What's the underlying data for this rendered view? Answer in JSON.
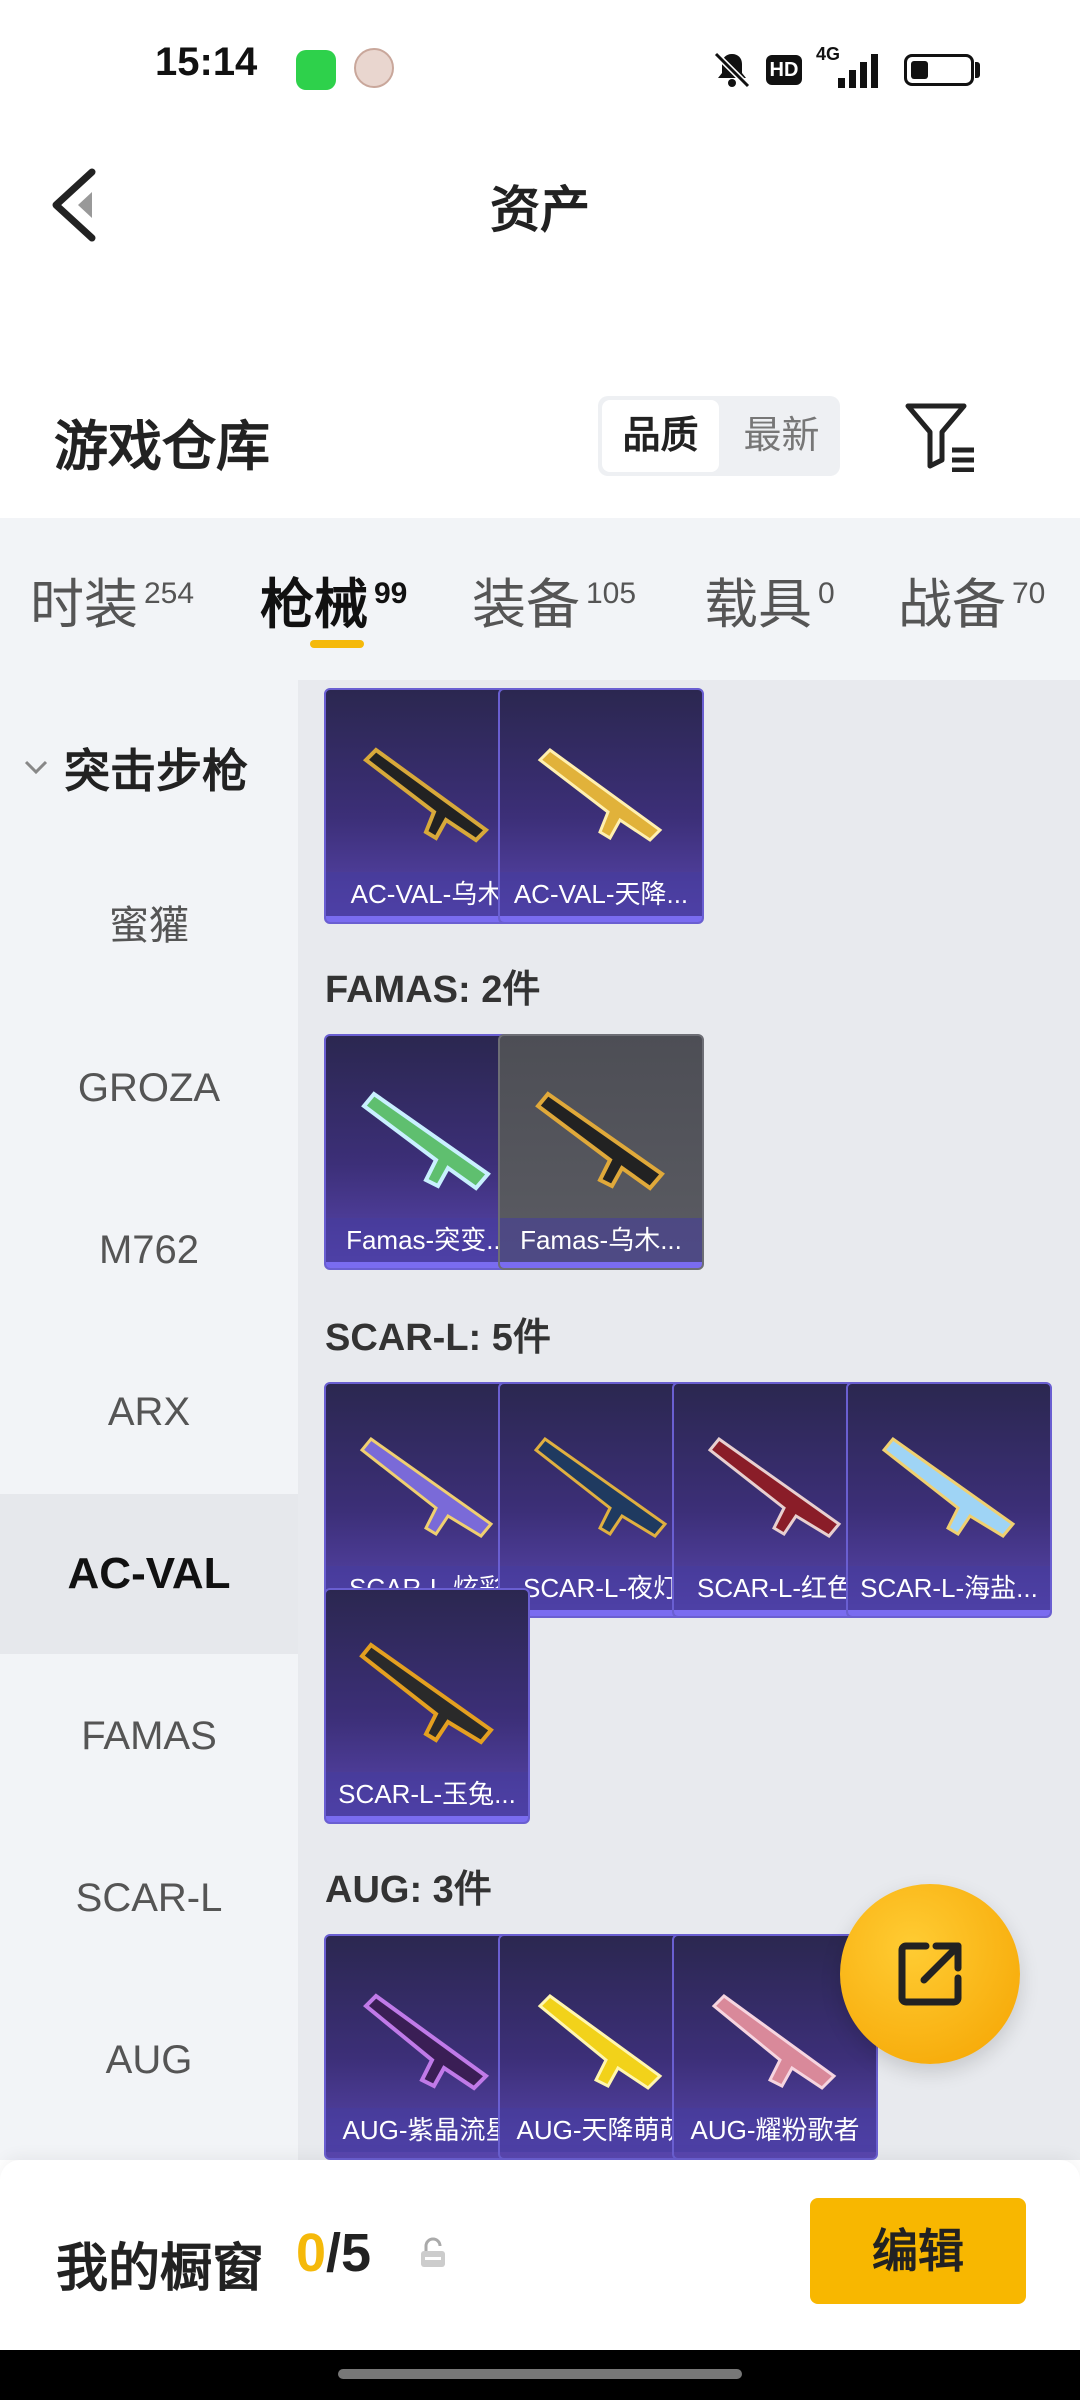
{
  "status_bar": {
    "time": "15:14",
    "hd": "HD",
    "network": "4G",
    "battery_level": 0.3
  },
  "header": {
    "title": "资产",
    "back_icon": "chevron-left-icon"
  },
  "warehouse": {
    "title": "游戏仓库",
    "sort_options": [
      "品质",
      "最新"
    ],
    "sort_selected": "品质",
    "filter_icon": "filter-icon"
  },
  "tabs": [
    {
      "label": "时装",
      "count": "254"
    },
    {
      "label": "枪械",
      "count": "99",
      "active": true
    },
    {
      "label": "装备",
      "count": "105"
    },
    {
      "label": "载具",
      "count": "0"
    },
    {
      "label": "战备",
      "count": "70"
    }
  ],
  "sidebar": {
    "header": "突击步枪",
    "items": [
      "蜜獾",
      "GROZA",
      "M762",
      "ARX",
      "AC-VAL",
      "FAMAS",
      "SCAR-L",
      "AUG"
    ],
    "active": "AC-VAL"
  },
  "sections": [
    {
      "label": "",
      "cards": [
        "AC-VAL-乌木",
        "AC-VAL-天降..."
      ]
    },
    {
      "label": "FAMAS: 2件",
      "cards": [
        "Famas-突变...",
        "Famas-乌木..."
      ]
    },
    {
      "label": "SCAR-L: 5件",
      "cards": [
        "SCAR-L-炫彩",
        "SCAR-L-夜灯",
        "SCAR-L-红色",
        "SCAR-L-海盐...",
        "SCAR-L-玉兔..."
      ]
    },
    {
      "label": "AUG: 3件",
      "cards": [
        "AUG-紫晶流星",
        "AUG-天降萌萌",
        "AUG-耀粉歌者"
      ]
    }
  ],
  "fab": {
    "icon": "share-icon"
  },
  "showcase": {
    "label": "我的橱窗",
    "count": "0",
    "total": "/5",
    "lock_icon": "lock-icon"
  },
  "edit_button": "编辑",
  "colors": {
    "accent": "#f5b90a",
    "card_purple": "#3c2f78"
  }
}
